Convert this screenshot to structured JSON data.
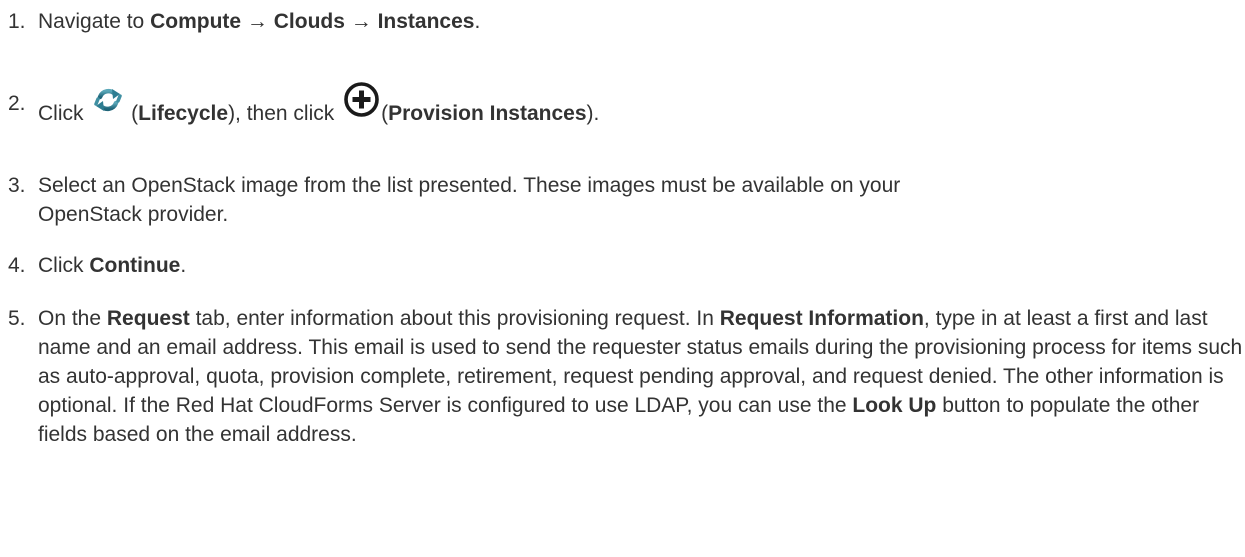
{
  "steps": [
    {
      "number": "1.",
      "prefix": "Navigate to ",
      "nav_compute": "Compute",
      "arrow1": " → ",
      "nav_clouds": "Clouds",
      "arrow2": " → ",
      "nav_instances": "Instances",
      "suffix": "."
    },
    {
      "number": "2.",
      "prefix": "Click ",
      "paren_open1": " (",
      "lifecycle_label": "Lifecycle",
      "middle": "), then click ",
      "paren_open2": "(",
      "provision_label": "Provision Instances",
      "suffix": ")."
    },
    {
      "number": "3.",
      "line1": "Select an OpenStack image from the list presented. These images must be available on your",
      "line2": "OpenStack provider."
    },
    {
      "number": "4.",
      "prefix": "Click ",
      "continue_label": "Continue",
      "suffix": "."
    },
    {
      "number": "5.",
      "prefix": "On the ",
      "request_tab": "Request",
      "mid1": " tab, enter information about this provisioning request. In ",
      "request_info": "Request Information",
      "mid2": ", type in at least a first and last name and an email address. This email is used to send the requester status emails during the provisioning process for items such as auto-approval, quota, provision complete, retirement, request pending approval, and request denied. The other information is optional. If the Red Hat CloudForms Server is configured to use LDAP, you can use the ",
      "lookup_label": "Look Up",
      "suffix": " button to populate the other fields based on the email address."
    }
  ],
  "icons": {
    "lifecycle": "recycle-arrows-icon",
    "provision": "plus-circle-icon",
    "lifecycle_color": "#2e7d91",
    "provision_color": "#1a1a1a"
  }
}
